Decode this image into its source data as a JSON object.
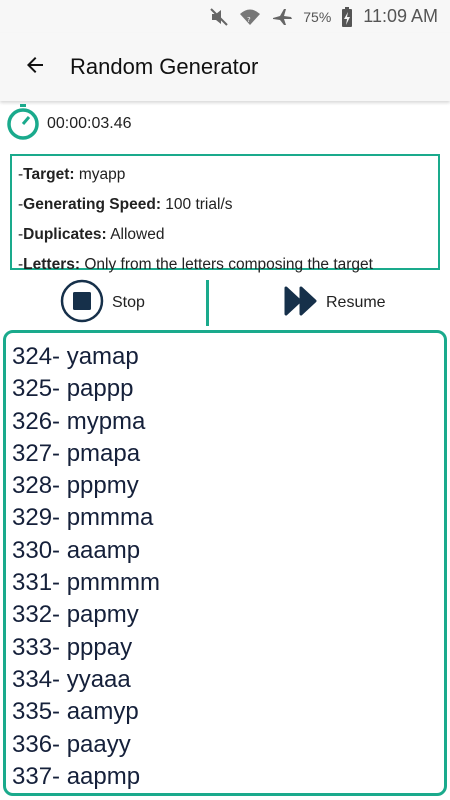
{
  "status_bar": {
    "battery_percent": "75%",
    "time": "11:09 AM",
    "icons": [
      "mute-icon",
      "wifi-icon",
      "airplane-icon",
      "battery-charging-icon"
    ]
  },
  "app_bar": {
    "title": "Random Generator",
    "back_icon": "arrow-left-icon"
  },
  "timer": {
    "icon": "stopwatch-icon",
    "elapsed": "00:00:03.46"
  },
  "info": {
    "target": {
      "label": "Target:",
      "value": "myapp"
    },
    "speed": {
      "label": "Generating Speed:",
      "value": "100 trial/s"
    },
    "duplicates": {
      "label": "Duplicates:",
      "value": "Allowed"
    },
    "letters": {
      "label": "Letters:",
      "value": "Only from the letters composing the target"
    }
  },
  "controls": {
    "stop_label": "Stop",
    "resume_label": "Resume"
  },
  "results": [
    "324- yamap",
    "325- pappp",
    "326- mypma",
    "327- pmapa",
    "328- pppmy",
    "329- pmmma",
    "330- aaamp",
    "331- pmmmm",
    "332- papmy",
    "333- pppay",
    "334- yyaaa",
    "335- aamyp",
    "336- paayy",
    "337- aapmp"
  ],
  "colors": {
    "accent": "#1aaa8c",
    "dark_icon": "#16304a",
    "bar_background": "#f7f7f7"
  }
}
